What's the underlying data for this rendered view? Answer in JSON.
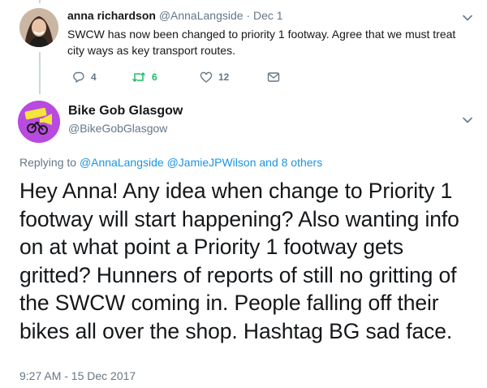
{
  "reply_tweet": {
    "author_name": "anna richardson",
    "author_handle": "@AnnaLangside",
    "date": "· Dec 1",
    "text": "SWCW has now been changed to priority 1 footway. Agree that we must treat city ways as key transport routes.",
    "reply_count": "4",
    "retweet_count": "6",
    "like_count": "12",
    "icons": [
      "reply-icon",
      "retweet-icon",
      "like-icon",
      "message-icon",
      "chevron-down-icon"
    ]
  },
  "main_tweet": {
    "author_name": "Bike Gob Glasgow",
    "author_handle": "@BikeGobGlasgow",
    "replying_prefix": "Replying to",
    "replying_to_1": "@AnnaLangside",
    "replying_to_2": "@JamieJPWilson",
    "replying_suffix": "and 8 others",
    "text": "Hey Anna! Any idea when change to Priority 1 footway will start happening? Also wanting info on at what point a Priority 1 footway gets gritted? Hunners of reports of still no gritting of the SWCW coming in. People falling off their bikes all over the shop. Hashtag BG sad face.",
    "timestamp": "9:27 AM - 15 Dec 2017"
  },
  "colors": {
    "text": "#14171a",
    "muted": "#657786",
    "link": "#1b95e0",
    "retweet_green": "#17bf63",
    "thread_line": "#ccd6dd",
    "bike_avatar": "#b84ae0"
  }
}
